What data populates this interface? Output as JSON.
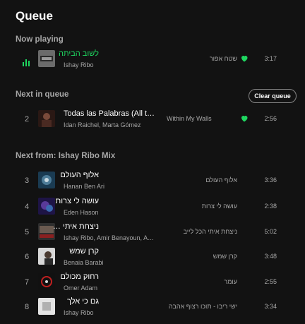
{
  "title": "Queue",
  "now_playing": {
    "label": "Now playing",
    "track": {
      "song": "לשוב הביתה",
      "artist": "Ishay Ribo",
      "album": "שטח אפור",
      "duration": "3:17",
      "liked": true
    }
  },
  "next_in_queue": {
    "label": "Next in queue",
    "clear_label": "Clear queue",
    "tracks": [
      {
        "index": "2",
        "song": "Todas las Palabras (All the Words)",
        "artist": "Idan Raichel, Marta Gómez",
        "album": "Within My Walls",
        "duration": "2:56",
        "liked": true
      }
    ]
  },
  "next_from": {
    "label": "Next from: Ishay Ribo Mix",
    "tracks": [
      {
        "index": "3",
        "song": "אלוף העולם",
        "artist": "Hanan Ben Ari",
        "album": "אלוף העולם",
        "duration": "3:36"
      },
      {
        "index": "4",
        "song": "עושה לי צרות",
        "artist": "Eden Hason",
        "album": "עושה לי צרות",
        "duration": "2:38"
      },
      {
        "index": "5",
        "song": "ניצחת איתי הכל לייב",
        "artist": "Ishay Ribo, Amir Benayoun, Amir Dadon",
        "album": "ניצחת איתי הכל לייב",
        "duration": "5:02"
      },
      {
        "index": "6",
        "song": "קרן שמש",
        "artist": "Benaia Barabi",
        "album": "קרן שמש",
        "duration": "3:48"
      },
      {
        "index": "7",
        "song": "רחוק מכולם",
        "artist": "Omer Adam",
        "album": "עומר",
        "duration": "2:55"
      },
      {
        "index": "8",
        "song": "גם כי אלך",
        "artist": "Ishay Ribo",
        "album": "ישי ריבו - תוכו רצוף אהבה",
        "duration": "3:34"
      }
    ]
  },
  "colors": {
    "accent": "#1ed760",
    "background": "#121212",
    "muted": "#a7a7a7"
  }
}
